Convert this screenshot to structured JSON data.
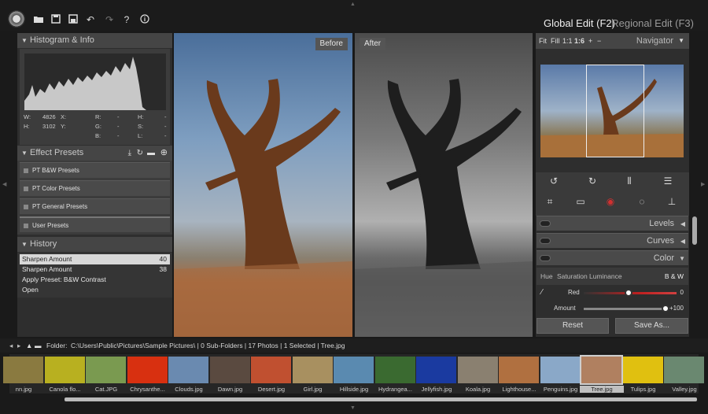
{
  "toolbar": {
    "icons": [
      "camera-logo",
      "open-icon",
      "save-icon",
      "save-as-icon",
      "undo-icon",
      "redo-icon",
      "help-icon",
      "info-icon"
    ],
    "help_label": "?",
    "mode_global": "Global Edit (F2)",
    "mode_regional": "Regional Edit (F3)"
  },
  "histogram": {
    "title": "Histogram & Info",
    "w_label": "W:",
    "w_value": "4826",
    "h_label": "H:",
    "h_value": "3102",
    "x_label": "X:",
    "y_label": "Y:",
    "r_label": "R:",
    "g_label": "G:",
    "b_label": "B:",
    "h2_label": "H:",
    "s_label": "S:",
    "l_label": "L:",
    "dash": "-"
  },
  "presets": {
    "title": "Effect Presets",
    "items": [
      "PT B&W Presets",
      "PT Color Presets",
      "PT General Presets",
      "User Presets"
    ]
  },
  "history": {
    "title": "History",
    "items": [
      {
        "name": "Sharpen Amount",
        "value": "40"
      },
      {
        "name": "Sharpen Amount",
        "value": "38"
      },
      {
        "name": "Apply Preset: B&W Contrast",
        "value": ""
      },
      {
        "name": "Open",
        "value": ""
      }
    ]
  },
  "compare": {
    "before": "Before",
    "after": "After"
  },
  "navigator": {
    "fit": "Fit",
    "fill": "Fill",
    "one_to_one": "1:1",
    "zoom": "1:6",
    "plus": "+",
    "minus": "−",
    "title": "Navigator"
  },
  "adjustments": {
    "levels": "Levels",
    "curves": "Curves",
    "color": "Color",
    "tabs": {
      "hue": "Hue",
      "saturation": "Saturation",
      "luminance": "Luminance",
      "bw": "B & W"
    },
    "red_label": "Red",
    "red_value": "0",
    "amount_label": "Amount",
    "amount_value": "+100",
    "red_fraction": 0.48,
    "amount_fraction": 1.0
  },
  "buttons": {
    "reset": "Reset",
    "save_as": "Save As..."
  },
  "folderbar": {
    "label": "Folder:",
    "path": "C:\\Users\\Public\\Pictures\\Sample Pictures\\ | 0 Sub-Folders | 17 Photos | 1 Selected | Tree.jpg"
  },
  "thumbnails": [
    {
      "name": "nn.jpg",
      "color": "#8a7a40"
    },
    {
      "name": "Canola flo...",
      "color": "#b8b020"
    },
    {
      "name": "Cat.JPG",
      "color": "#7a9a50"
    },
    {
      "name": "Chrysanthe...",
      "color": "#d83010"
    },
    {
      "name": "Clouds.jpg",
      "color": "#6a8ab0"
    },
    {
      "name": "Dawn.jpg",
      "color": "#5a4a40"
    },
    {
      "name": "Desert.jpg",
      "color": "#c05030"
    },
    {
      "name": "Girl.jpg",
      "color": "#a89060"
    },
    {
      "name": "Hillside.jpg",
      "color": "#5a8ab0"
    },
    {
      "name": "Hydrangea...",
      "color": "#3a6a30"
    },
    {
      "name": "Jellyfish.jpg",
      "color": "#1a3aa0"
    },
    {
      "name": "Koala.jpg",
      "color": "#8a8070"
    },
    {
      "name": "Lighthouse...",
      "color": "#b07040"
    },
    {
      "name": "Penguins.jpg",
      "color": "#8aa8c8"
    },
    {
      "name": "Tree.jpg",
      "color": "#b08060"
    },
    {
      "name": "Tulips.jpg",
      "color": "#e0c010"
    },
    {
      "name": "Valley.jpg",
      "color": "#6a8870"
    }
  ]
}
